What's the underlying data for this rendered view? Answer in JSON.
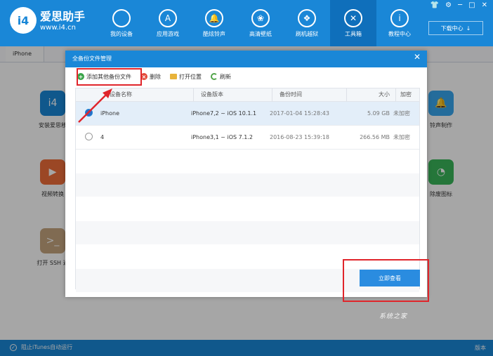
{
  "app": {
    "logo_text": "i4",
    "brand": "爱思助手",
    "url": "www.i4.cn",
    "window_controls": [
      "👕",
      "⚙",
      "─",
      "□",
      "✕"
    ],
    "download_label": "下载中心",
    "download_icon": "↓"
  },
  "nav": [
    {
      "label": "我的设备",
      "icon": "apple-icon",
      "glyph": ""
    },
    {
      "label": "应用游戏",
      "icon": "app-store-icon",
      "glyph": "A"
    },
    {
      "label": "酷炫铃声",
      "icon": "bell-icon",
      "glyph": "🔔"
    },
    {
      "label": "高清壁纸",
      "icon": "flower-icon",
      "glyph": "❀"
    },
    {
      "label": "刷机越狱",
      "icon": "box-icon",
      "glyph": "❖"
    },
    {
      "label": "工具箱",
      "icon": "tools-icon",
      "glyph": "✕"
    },
    {
      "label": "教程中心",
      "icon": "info-icon",
      "glyph": "i"
    }
  ],
  "device_tab": "iPhone",
  "tools": [
    {
      "label": "安装爱思移",
      "icon": "i4-icon",
      "color": "#1a87d7",
      "glyph": "i4"
    },
    {
      "label": "视频转换",
      "icon": "play-icon",
      "color": "#ef6d3a",
      "glyph": "▶"
    },
    {
      "label": "打开 SSH 通",
      "icon": "terminal-icon",
      "color": "#c5a57f",
      "glyph": ">_"
    },
    {
      "label": "铃声制作",
      "icon": "bell-icon",
      "color": "#38a7ef",
      "glyph": "🔔"
    },
    {
      "label": "除废图标",
      "icon": "pie-icon",
      "color": "#39b55a",
      "glyph": "◔"
    }
  ],
  "statusbar": {
    "itunes_label": "阻止iTunes自动运行",
    "version": "版本"
  },
  "watermark": "系统之家",
  "dialog": {
    "title": "全备份文件管理",
    "close": "✕",
    "toolbar": {
      "add": "添加其他备份文件",
      "delete": "删除",
      "open": "打开位置",
      "refresh": "刷新"
    },
    "columns": [
      "设备名称",
      "设备版本",
      "备份时间",
      "大小",
      "加密"
    ],
    "rows": [
      {
        "name": "iPhone",
        "version": "iPhone7,2 ~ iOS 10.1.1",
        "time": "2017-01-04 15:28:43",
        "size": "5.09 GB",
        "encrypt": "未加密",
        "selected": true
      },
      {
        "name": "4",
        "version": "iPhone3,1 ~ iOS 7.1.2",
        "time": "2016-08-23 15:39:18",
        "size": "266.56 MB",
        "encrypt": "未加密",
        "selected": false
      }
    ],
    "view_button": "立即查看"
  },
  "colors": {
    "accent": "#1a87d7",
    "highlight": "#e0252b"
  }
}
